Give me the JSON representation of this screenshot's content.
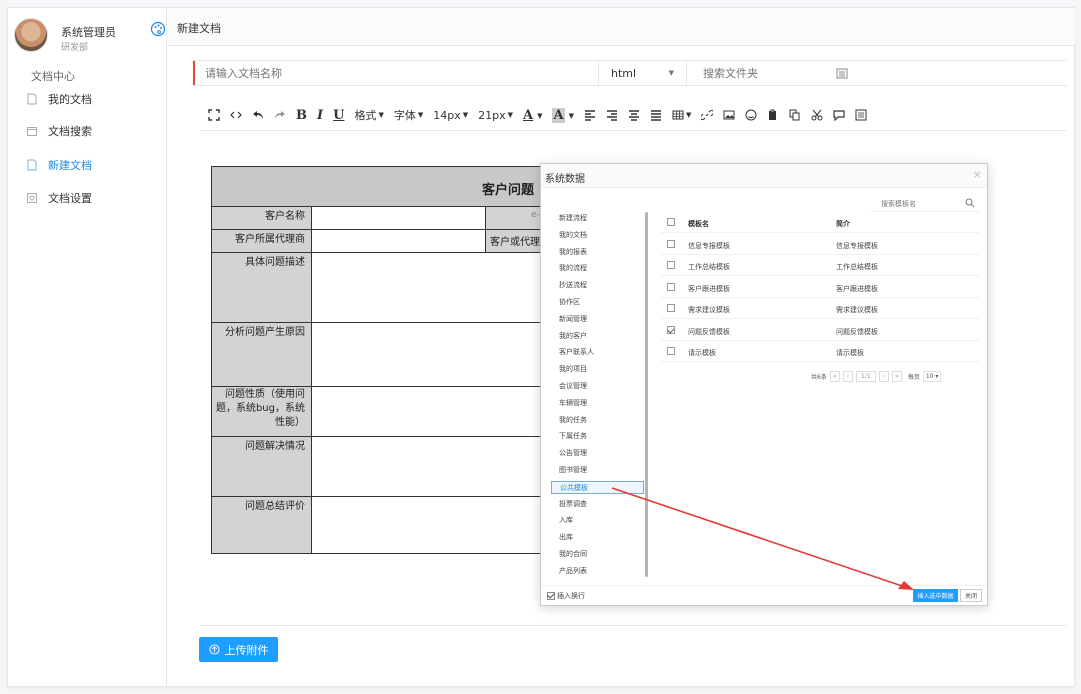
{
  "user": {
    "name": "系统管理员",
    "dept": "研发部"
  },
  "sidebar": {
    "title": "文档中心",
    "items": [
      {
        "label": "我的文档"
      },
      {
        "label": "文档搜索"
      },
      {
        "label": "新建文档"
      },
      {
        "label": "文档设置"
      }
    ]
  },
  "header": {
    "title": "新建文档"
  },
  "form": {
    "name_placeholder": "请输入文档名称",
    "format": "html",
    "folder_placeholder": "搜索文件夹"
  },
  "toolbar": {
    "format": "格式",
    "font": "字体",
    "size": "14px",
    "line_height": "21px"
  },
  "document": {
    "title": "客户问题",
    "rows": [
      {
        "label": "客户名称",
        "mid": "e-oa"
      },
      {
        "label": "客户所属代理商",
        "mid": "客户或代理商"
      },
      {
        "label": "具体问题描述",
        "mid": ""
      },
      {
        "label": "分析问题产生原因",
        "mid": ""
      },
      {
        "label": "问题性质（使用问题，系统bug，系统性能）",
        "mid": ""
      },
      {
        "label": "问题解决情况",
        "mid": ""
      },
      {
        "label": "问题总结评价",
        "mid": ""
      }
    ]
  },
  "upload_label": "上传附件",
  "modal": {
    "title": "系统数据",
    "search_placeholder": "搜索模板名",
    "list": [
      "新建流程",
      "我的文档",
      "我的报表",
      "我的流程",
      "抄送流程",
      "协作区",
      "新闻管理",
      "我的客户",
      "客户联系人",
      "我的项目",
      "会议管理",
      "车辆管理",
      "我的任务",
      "下属任务",
      "公告管理",
      "图书管理",
      "公共模板",
      "投票调查",
      "入库",
      "出库",
      "我的合同",
      "产品列表"
    ],
    "selected_index": 16,
    "table": {
      "head": {
        "name": "模板名",
        "desc": "简介"
      },
      "rows": [
        {
          "name": "信息专报模板",
          "desc": "信息专报模板",
          "checked": false
        },
        {
          "name": "工作总结模板",
          "desc": "工作总结模板",
          "checked": false
        },
        {
          "name": "客户跟进模板",
          "desc": "客户跟进模板",
          "checked": false
        },
        {
          "name": "需求建议模板",
          "desc": "需求建议模板",
          "checked": false
        },
        {
          "name": "问题反馈模板",
          "desc": "问题反馈模板",
          "checked": true
        },
        {
          "name": "请示模板",
          "desc": "请示模板",
          "checked": false
        }
      ]
    },
    "pager": {
      "total": "共6条",
      "page": "1/1",
      "per_page_label": "每页",
      "per_page": "10"
    },
    "insert_line": "插入换行",
    "insert_btn": "插入选中数据",
    "close_btn": "关闭"
  },
  "colors": {
    "accent": "#1e9fff",
    "active_nav": "#1e88e5",
    "arrow": "#e53935",
    "required": "#ea4335"
  }
}
